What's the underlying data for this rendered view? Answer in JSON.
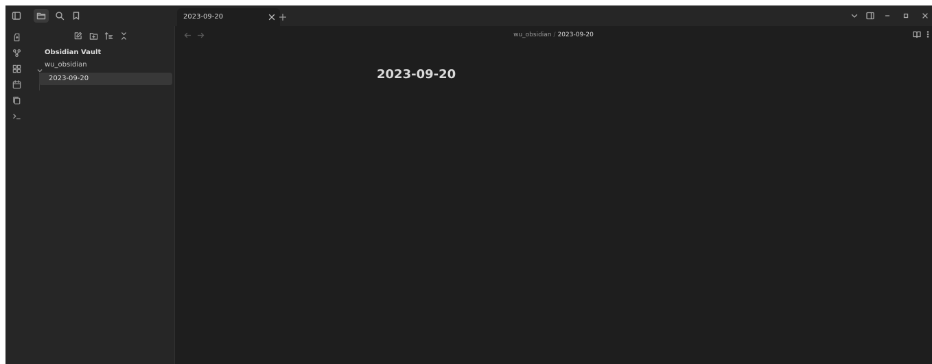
{
  "tabs": [
    {
      "title": "2023-09-20",
      "active": true
    }
  ],
  "sidebar": {
    "vault_name": "Obsidian Vault",
    "tree": {
      "folder": "wu_obsidian",
      "files": [
        "2023-09-20"
      ]
    }
  },
  "main": {
    "breadcrumb": {
      "folder": "wu_obsidian",
      "separator": "/",
      "file": "2023-09-20"
    },
    "note_title": "2023-09-20"
  },
  "icons": {
    "titlebar": [
      "sidebar-toggle-icon",
      "folder-icon",
      "search-icon",
      "bookmark-icon"
    ],
    "ribbon": [
      "open-quick-switcher-icon",
      "graph-view-icon",
      "canvas-icon",
      "calendar-icon",
      "templates-icon",
      "command-palette-icon"
    ],
    "file_nav": [
      "new-note-icon",
      "new-folder-icon",
      "sort-icon",
      "collapse-all-icon"
    ],
    "window": [
      "tab-list-icon",
      "right-sidebar-icon",
      "minimize-icon",
      "maximize-icon",
      "close-icon"
    ]
  },
  "colors": {
    "background": "#1e1e1e",
    "sidebar": "#262626",
    "selected_item": "#383838",
    "text": "#dadada"
  }
}
